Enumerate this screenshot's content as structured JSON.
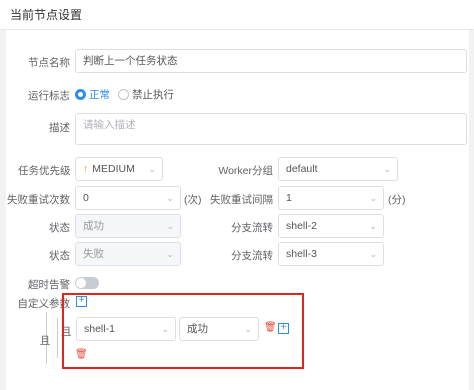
{
  "header": {
    "title": "当前节点设置"
  },
  "form": {
    "node_name": {
      "label": "节点名称",
      "value": "判断上一个任务状态"
    },
    "run_flag": {
      "label": "运行标志",
      "options": [
        "正常",
        "禁止执行"
      ],
      "selected": "正常"
    },
    "description": {
      "label": "描述",
      "placeholder": "请输入描述"
    },
    "priority": {
      "label": "任务优先级",
      "value": "MEDIUM"
    },
    "worker_group": {
      "label": "Worker分组",
      "value": "default"
    },
    "retry_times": {
      "label": "失败重试次数",
      "value": "0",
      "unit": "(次)"
    },
    "retry_interval": {
      "label": "失败重试间隔",
      "value": "1",
      "unit": "(分)"
    },
    "condition_1": {
      "label": "状态",
      "value": "成功",
      "branch_label": "分支流转",
      "branch_value": "shell-2"
    },
    "condition_2": {
      "label": "状态",
      "value": "失败",
      "branch_label": "分支流转",
      "branch_value": "shell-3"
    },
    "timeout_alarm": {
      "label": "超时告警",
      "enabled": false
    },
    "custom_params": {
      "label": "自定义参数",
      "relation": "且",
      "inner_relation": "且",
      "row": {
        "task": "shell-1",
        "status": "成功"
      }
    }
  },
  "colors": {
    "accent": "#2d8cf0",
    "priority_arrow": "#f29c36",
    "danger": "#e74c3c",
    "highlight_box": "#e1251b"
  }
}
